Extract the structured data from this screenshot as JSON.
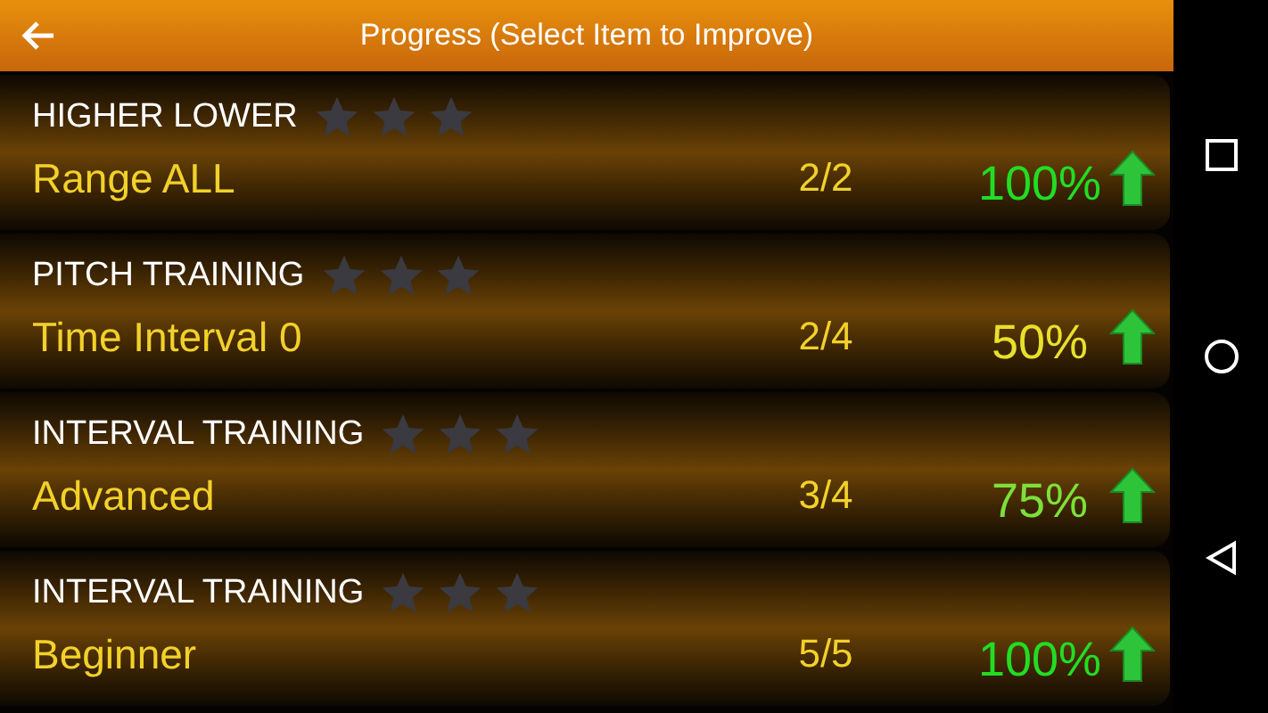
{
  "app_bar": {
    "title": "Progress (Select Item to Improve)"
  },
  "items": [
    {
      "category": "HIGHER LOWER",
      "stars": 0,
      "name": "Range ALL",
      "score": "2/2",
      "percent": "100%",
      "color": "#22dd22"
    },
    {
      "category": "PITCH TRAINING",
      "stars": 0,
      "name": "Time Interval 0",
      "score": "2/4",
      "percent": "50%",
      "color": "#e8e02a"
    },
    {
      "category": "INTERVAL TRAINING",
      "stars": 0,
      "name": "Advanced",
      "score": "3/4",
      "percent": "75%",
      "color": "#7de03a"
    },
    {
      "category": "INTERVAL TRAINING",
      "stars": 0,
      "name": "Beginner",
      "score": "5/5",
      "percent": "100%",
      "color": "#22dd22"
    }
  ]
}
